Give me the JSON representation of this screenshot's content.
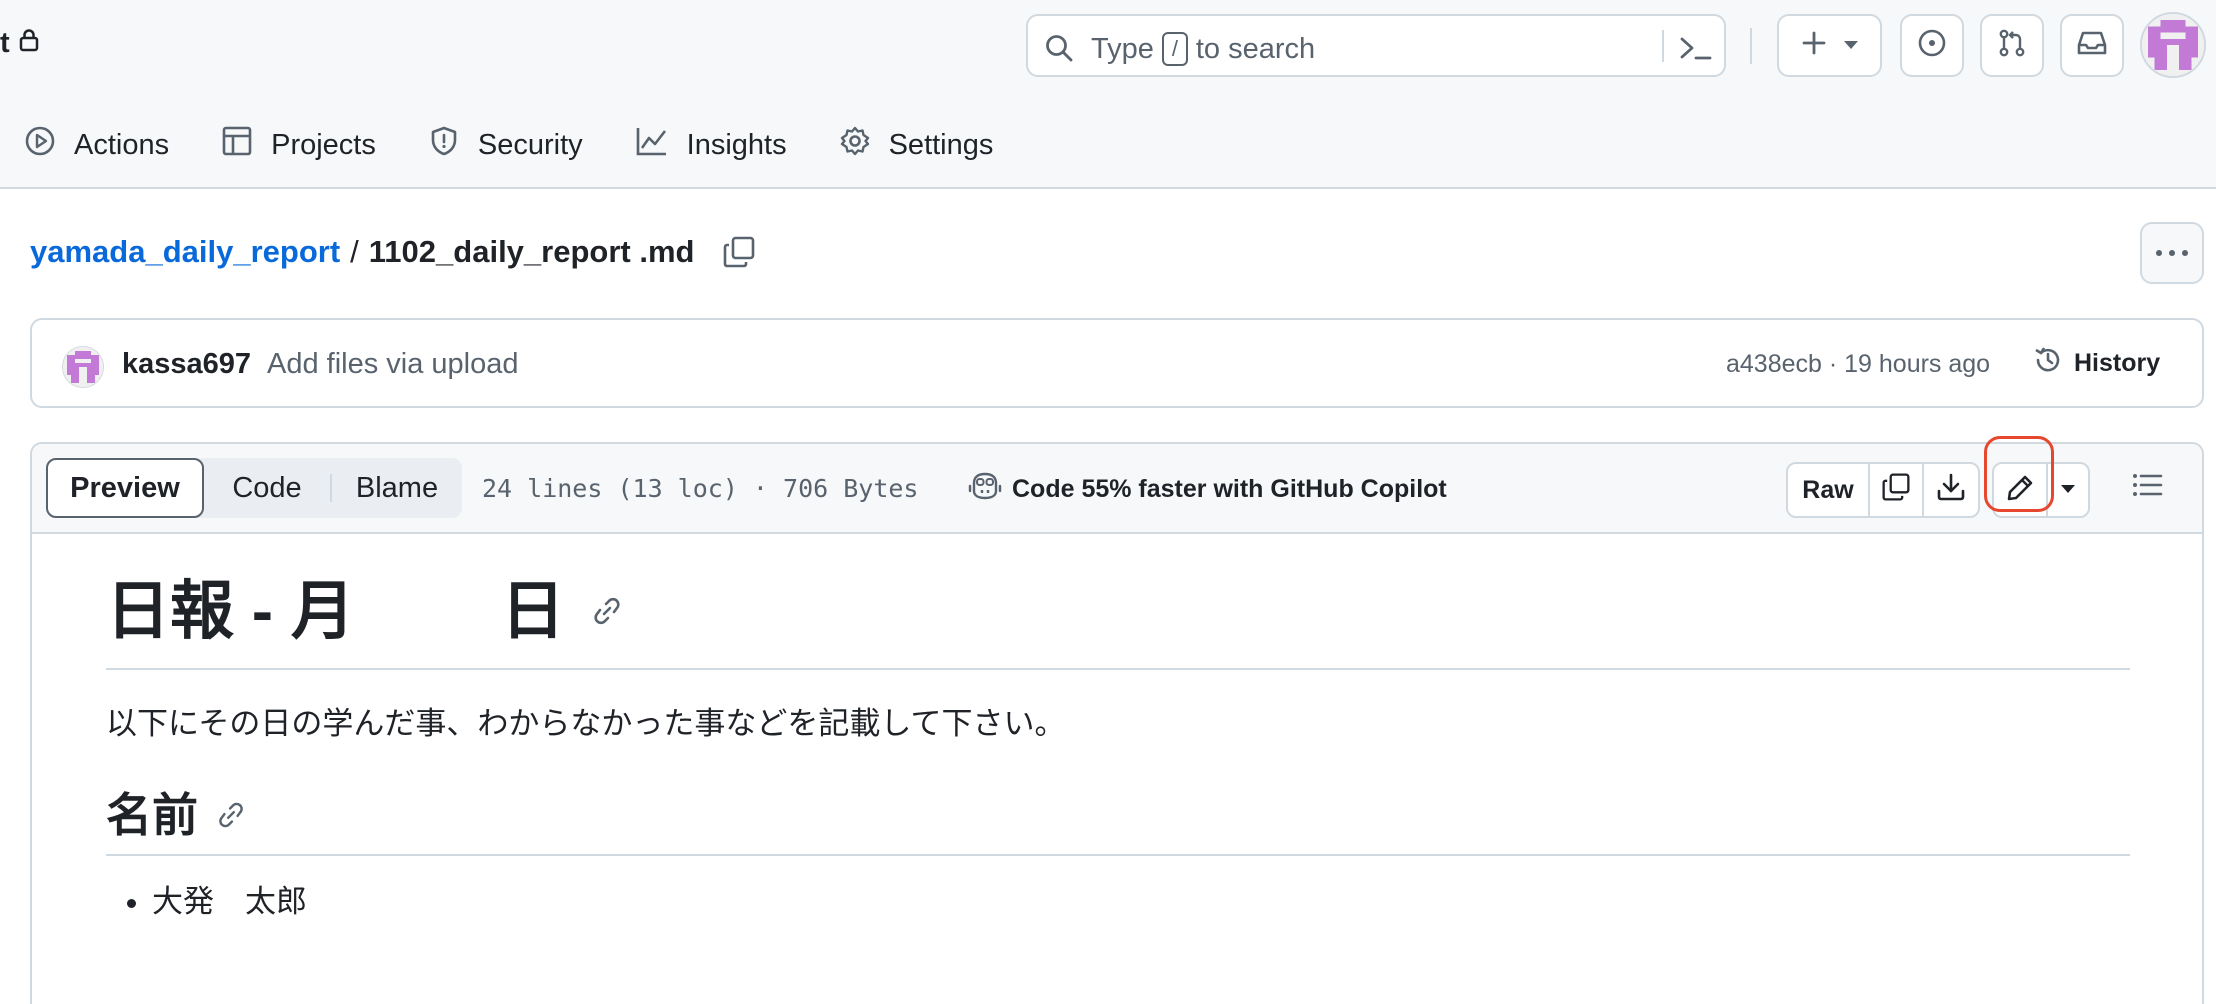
{
  "header": {
    "repo_fragment": "t",
    "search": {
      "placeholder_pre": "Type",
      "key": "/",
      "placeholder_post": "to search"
    },
    "buttons": [
      "create-new",
      "issues",
      "pull-requests",
      "inbox"
    ]
  },
  "repo_nav": {
    "items": [
      {
        "label": "Actions",
        "icon": "play-icon"
      },
      {
        "label": "Projects",
        "icon": "table-icon"
      },
      {
        "label": "Security",
        "icon": "shield-icon"
      },
      {
        "label": "Insights",
        "icon": "graph-icon"
      },
      {
        "label": "Settings",
        "icon": "gear-icon"
      }
    ]
  },
  "breadcrumb": {
    "repo": "yamada_daily_report",
    "separator": "/",
    "file": "1102_daily_report .md"
  },
  "commit": {
    "author": "kassa697",
    "message": "Add files via upload",
    "meta": "a438ecb · 19 hours ago",
    "history_label": "History"
  },
  "file_toolbar": {
    "tabs": {
      "preview": "Preview",
      "code": "Code",
      "blame": "Blame"
    },
    "stats": "24 lines (13 loc) · 706 Bytes",
    "copilot": "Code 55% faster with GitHub Copilot",
    "raw_label": "Raw"
  },
  "markdown": {
    "h1_part1": "日報 - 月",
    "h1_part2": "日",
    "intro": "以下にその日の学んだ事、わからなかった事などを記載して下さい。",
    "h2": "名前",
    "list": [
      "大発　太郎"
    ]
  },
  "colors": {
    "link": "#0969da",
    "border": "#d1d9e0",
    "header_bg": "#f6f8fa",
    "highlight": "#e5472f",
    "avatar": "#c27ad6"
  }
}
